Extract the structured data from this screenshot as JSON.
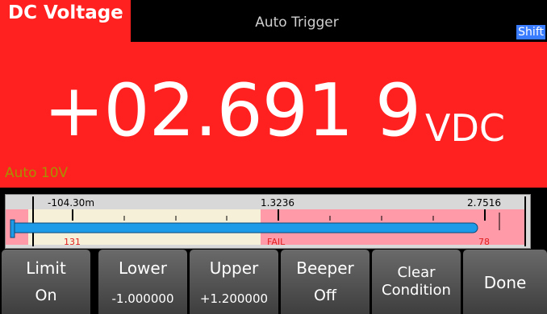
{
  "header": {
    "function": "DC Voltage",
    "trigger": "Auto Trigger",
    "shift": "Shift"
  },
  "display": {
    "reading": "+02.691 9",
    "unit": "VDC",
    "range": "Auto 10V"
  },
  "limit_bar": {
    "scale_left": "-104.30m",
    "scale_mid": "1.3236",
    "scale_right": "2.7516",
    "count_left": "131",
    "status": "FAIL",
    "count_right": "78",
    "reading_fraction": 0.89,
    "colors": {
      "pass_zone": "#f7f0d8",
      "fail_zone": "#ff9aa8",
      "needle": "#1e9be8",
      "count": "#e02020"
    }
  },
  "softkeys": [
    {
      "label": "Limit",
      "value": "On"
    },
    {
      "label": "Lower",
      "value": "-1.000000"
    },
    {
      "label": "Upper",
      "value": "+1.200000"
    },
    {
      "label": "Beeper",
      "value": "Off"
    },
    {
      "label": "Clear",
      "value": "Condition"
    },
    {
      "label": "Done",
      "value": ""
    }
  ]
}
